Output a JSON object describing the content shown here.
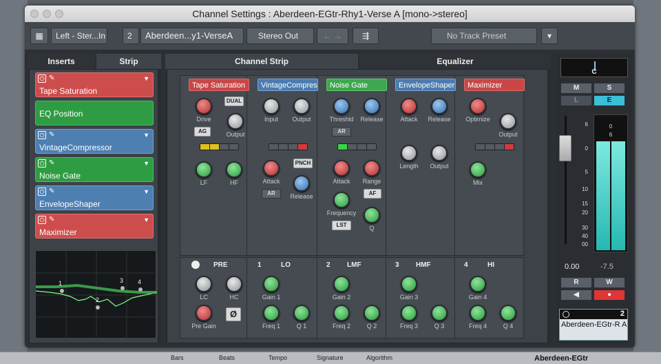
{
  "window": {
    "title": "Channel Settings : Aberdeen-EGtr-Rhy1-Verse A [mono->stereo]"
  },
  "toolbar": {
    "input_routing": "Left - Ster...In",
    "channel_number": "2",
    "channel_name": "Aberdeen...y1-VerseA",
    "output_routing": "Stereo Out",
    "track_preset": "No Track Preset"
  },
  "tabs": {
    "inserts": "Inserts",
    "strip": "Strip",
    "channel_strip": "Channel Strip",
    "equalizer": "Equalizer"
  },
  "slots": [
    {
      "label": "Tape Saturation",
      "color": "#cd4d4d"
    },
    {
      "label": "EQ Position",
      "color": "#2e9c42"
    },
    {
      "label": "VintageCompressor",
      "color": "#4d7fb1"
    },
    {
      "label": "Noise Gate",
      "color": "#2e9c42"
    },
    {
      "label": "EnvelopeShaper",
      "color": "#4d7fb1"
    },
    {
      "label": "Maximizer",
      "color": "#cd4d4d"
    }
  ],
  "eq_curve_labels": [
    "1",
    "2",
    "3",
    "4"
  ],
  "modules": {
    "tape": {
      "title": "Tape Saturation",
      "drive": "Drive",
      "dual": "DUAL",
      "ag": "AG",
      "output": "Output",
      "lf": "LF",
      "hf": "HF"
    },
    "vcomp": {
      "title": "VintageCompressor",
      "input": "Input",
      "output": "Output",
      "attack": "Attack",
      "punch": "PNCH",
      "release": "Release",
      "ar": "AR"
    },
    "gate": {
      "title": "Noise Gate",
      "threshold": "Threshld",
      "release": "Release",
      "ar": "AR",
      "attack": "Attack",
      "range": "Range",
      "af": "AF",
      "frequency": "Frequency",
      "lst": "LST",
      "q": "Q"
    },
    "env": {
      "title": "EnvelopeShaper",
      "attack": "Attack",
      "release": "Release",
      "length": "Length",
      "output": "Output"
    },
    "max": {
      "title": "Maximizer",
      "optimize": "Optimize",
      "output": "Output",
      "mix": "Mix"
    }
  },
  "pre": {
    "label": "PRE",
    "lc": "LC",
    "hc": "HC",
    "pre_gain": "Pre Gain",
    "phase": "Ø"
  },
  "eq_bands": [
    {
      "num": "1",
      "name": "LO",
      "gain": "Gain 1",
      "freq": "Freq 1",
      "q": "Q 1"
    },
    {
      "num": "2",
      "name": "LMF",
      "gain": "Gain 2",
      "freq": "Freq 2",
      "q": "Q 2"
    },
    {
      "num": "3",
      "name": "HMF",
      "gain": "Gain 3",
      "freq": "Freq 3",
      "q": "Q 3"
    },
    {
      "num": "4",
      "name": "HI",
      "gain": "Gain 4",
      "freq": "Freq 4",
      "q": "Q 4"
    }
  ],
  "fader": {
    "pan_label": "C",
    "mute": "M",
    "solo": "S",
    "listen": "L",
    "edit": "E",
    "scale": [
      "6",
      "0",
      "5",
      "10",
      "15",
      "20",
      "30",
      "40",
      "00"
    ],
    "meter_scale": [
      "0",
      "6"
    ],
    "volume": "0.00",
    "peak": "-7.5",
    "read": "R",
    "write": "W",
    "channel_number": "2",
    "channel_name": "Aberdeen-EGtr-R A"
  },
  "bottom_bar": {
    "bars": "Bars",
    "beats": "Beats",
    "tempo": "Tempo",
    "signature": "Signature",
    "algorithm": "Algorithm",
    "track": "Aberdeen-EGtr"
  }
}
